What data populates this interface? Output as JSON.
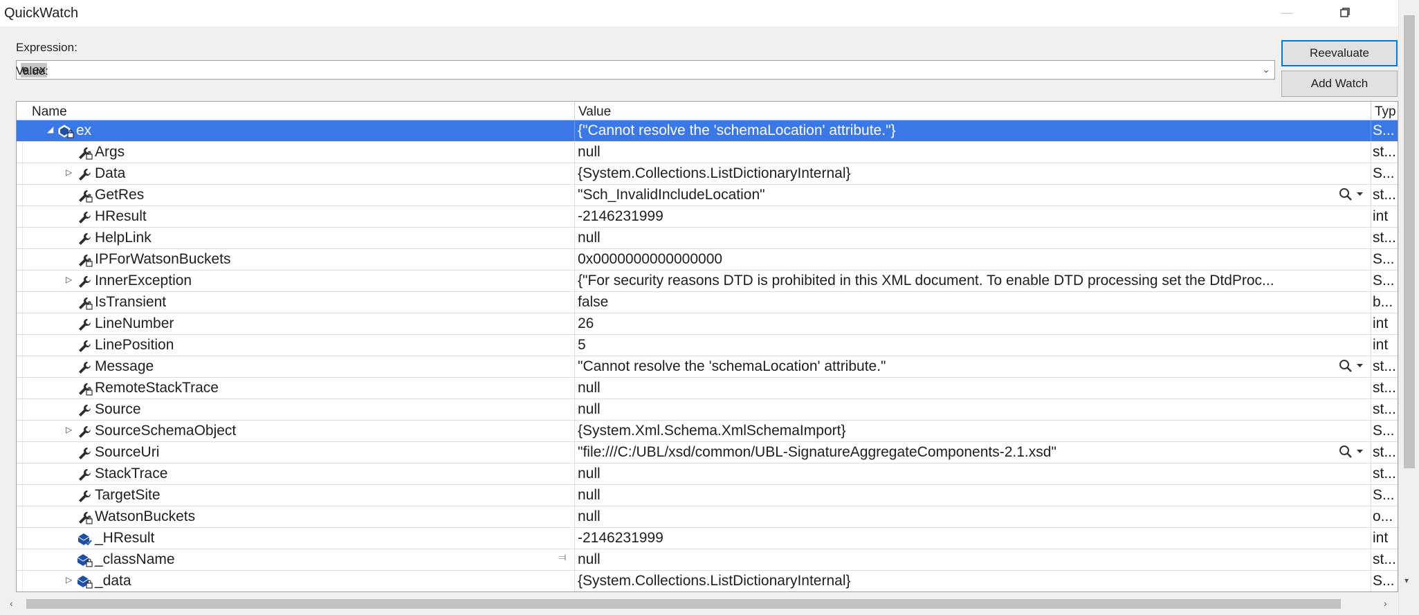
{
  "window": {
    "title": "QuickWatch"
  },
  "expression": {
    "label": "Expression:",
    "value": "e.ex"
  },
  "value_label": "Value:",
  "buttons": {
    "reevaluate": "Reevaluate",
    "add_watch": "Add Watch"
  },
  "columns": {
    "name": "Name",
    "value": "Value",
    "type": "Typ"
  },
  "rows": [
    {
      "name": "ex",
      "value": "{\"Cannot resolve the 'schemaLocation' attribute.\"}",
      "type": "S...",
      "icon": "object-lock-icon",
      "expander": "expanded",
      "selected": true,
      "level": 0
    },
    {
      "name": "Args",
      "value": "null",
      "type": "st...",
      "icon": "property-lock-icon",
      "expander": "none",
      "level": 1
    },
    {
      "name": "Data",
      "value": "{System.Collections.ListDictionaryInternal}",
      "type": "S...",
      "icon": "property-icon",
      "expander": "collapsed",
      "level": 1
    },
    {
      "name": "GetRes",
      "value": "\"Sch_InvalidIncludeLocation\"",
      "type": "st...",
      "icon": "property-lock-icon",
      "expander": "none",
      "level": 1,
      "magnifier": true
    },
    {
      "name": "HResult",
      "value": "-2146231999",
      "type": "int",
      "icon": "property-icon",
      "expander": "none",
      "level": 1
    },
    {
      "name": "HelpLink",
      "value": "null",
      "type": "st...",
      "icon": "property-icon",
      "expander": "none",
      "level": 1
    },
    {
      "name": "IPForWatsonBuckets",
      "value": "0x0000000000000000",
      "type": "S...",
      "icon": "property-lock-icon",
      "expander": "none",
      "level": 1
    },
    {
      "name": "InnerException",
      "value": "{\"For security reasons DTD is prohibited in this XML document. To enable DTD processing set the DtdProc...",
      "type": "S...",
      "icon": "property-icon",
      "expander": "collapsed",
      "level": 1
    },
    {
      "name": "IsTransient",
      "value": "false",
      "type": "b...",
      "icon": "property-lock-icon",
      "expander": "none",
      "level": 1
    },
    {
      "name": "LineNumber",
      "value": "26",
      "type": "int",
      "icon": "property-icon",
      "expander": "none",
      "level": 1
    },
    {
      "name": "LinePosition",
      "value": "5",
      "type": "int",
      "icon": "property-icon",
      "expander": "none",
      "level": 1
    },
    {
      "name": "Message",
      "value": "\"Cannot resolve the 'schemaLocation' attribute.\"",
      "type": "st...",
      "icon": "property-icon",
      "expander": "none",
      "level": 1,
      "magnifier": true
    },
    {
      "name": "RemoteStackTrace",
      "value": "null",
      "type": "st...",
      "icon": "property-lock-icon",
      "expander": "none",
      "level": 1
    },
    {
      "name": "Source",
      "value": "null",
      "type": "st...",
      "icon": "property-icon",
      "expander": "none",
      "level": 1
    },
    {
      "name": "SourceSchemaObject",
      "value": "{System.Xml.Schema.XmlSchemaImport}",
      "type": "S...",
      "icon": "property-icon",
      "expander": "collapsed",
      "level": 1
    },
    {
      "name": "SourceUri",
      "value": "\"file:///C:/UBL/xsd/common/UBL-SignatureAggregateComponents-2.1.xsd\"",
      "type": "st...",
      "icon": "property-icon",
      "expander": "none",
      "level": 1,
      "magnifier": true
    },
    {
      "name": "StackTrace",
      "value": "null",
      "type": "st...",
      "icon": "property-icon",
      "expander": "none",
      "level": 1
    },
    {
      "name": "TargetSite",
      "value": "null",
      "type": "S...",
      "icon": "property-icon",
      "expander": "none",
      "level": 1
    },
    {
      "name": "WatsonBuckets",
      "value": "null",
      "type": "o...",
      "icon": "property-lock-icon",
      "expander": "none",
      "level": 1
    },
    {
      "name": "_HResult",
      "value": "-2146231999",
      "type": "int",
      "icon": "field-icon",
      "expander": "none",
      "level": 1
    },
    {
      "name": "_className",
      "value": "null",
      "type": "st...",
      "icon": "field-lock-icon",
      "expander": "none",
      "level": 1,
      "pin": true
    },
    {
      "name": "_data",
      "value": "{System.Collections.ListDictionaryInternal}",
      "type": "S...",
      "icon": "field-lock-icon",
      "expander": "collapsed",
      "level": 1
    }
  ],
  "colors": {
    "selection": "#3b78e7",
    "icon_blue": "#1e4fa8",
    "icon_dark": "#2d2d30"
  }
}
